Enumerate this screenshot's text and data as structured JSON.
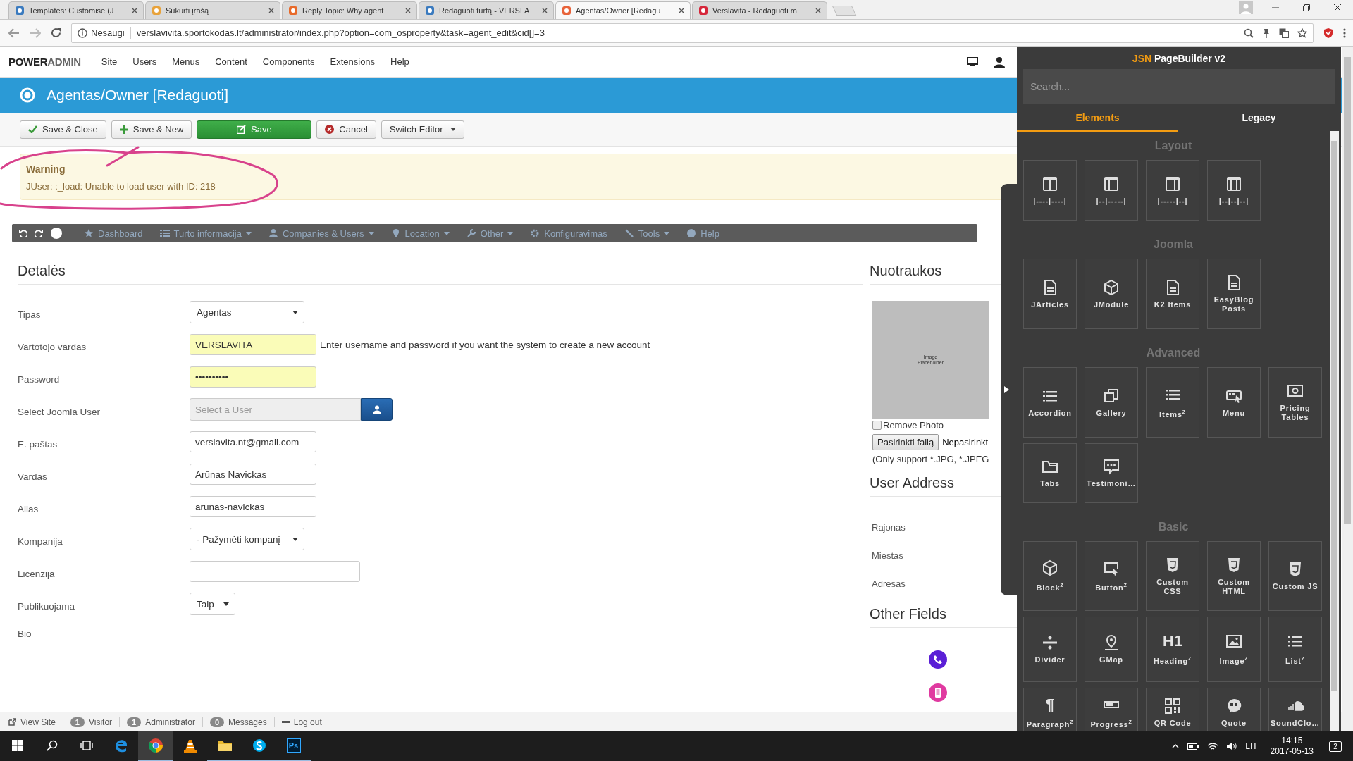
{
  "browser": {
    "tabs": [
      {
        "title": "Templates: Customise (J",
        "selected": false
      },
      {
        "title": "Sukurti įrašą",
        "selected": false
      },
      {
        "title": "Reply Topic: Why agent",
        "selected": false
      },
      {
        "title": "Redaguoti turtą - VERSLA",
        "selected": false
      },
      {
        "title": "Agentas/Owner [Redagu",
        "selected": true
      },
      {
        "title": "Verslavita - Redaguoti m",
        "selected": false
      }
    ],
    "security": "Nesaugi",
    "url": "verslavivita.sportokodas.lt/administrator/index.php?option=com_osproperty&task=agent_edit&cid[]=3"
  },
  "admin": {
    "logo": {
      "strong": "POWER",
      "light": "ADMIN"
    },
    "menu": [
      "Site",
      "Users",
      "Menus",
      "Content",
      "Components",
      "Extensions",
      "Help"
    ]
  },
  "title": "Agentas/Owner [Redaguoti]",
  "toolbar": [
    {
      "label": "Save & Close",
      "kind": "check"
    },
    {
      "label": "Save & New",
      "kind": "plus"
    },
    {
      "label": "Save",
      "kind": "primary"
    },
    {
      "label": "Cancel",
      "kind": "cancel"
    },
    {
      "label": "Switch Editor",
      "kind": "dropdown"
    }
  ],
  "alert": {
    "heading": "Warning",
    "message": "JUser: :_load: Unable to load user with ID: 218"
  },
  "submenu": [
    {
      "label": "Dashboard",
      "dropdown": false
    },
    {
      "label": "Turto informacija",
      "dropdown": true
    },
    {
      "label": "Companies & Users",
      "dropdown": true
    },
    {
      "label": "Location",
      "dropdown": true
    },
    {
      "label": "Other",
      "dropdown": true
    },
    {
      "label": "Konfiguravimas",
      "dropdown": false
    },
    {
      "label": "Tools",
      "dropdown": true
    },
    {
      "label": "Help",
      "dropdown": false
    }
  ],
  "details": {
    "heading": "Detalės",
    "rows": [
      {
        "label": "Tipas",
        "kind": "select",
        "value": "Agentas"
      },
      {
        "label": "Vartotojo vardas",
        "kind": "text",
        "value": "VERSLAVITA",
        "autofilled": true,
        "note": "Enter username and password if you want the system to create a new account"
      },
      {
        "label": "Password",
        "kind": "text",
        "value": "••••••••••",
        "autofilled": true
      },
      {
        "label": "Select Joomla User",
        "kind": "picker",
        "placeholder": "Select a User"
      },
      {
        "label": "E. paštas",
        "kind": "text",
        "value": "verslavita.nt@gmail.com",
        "autofilled": false
      },
      {
        "label": "Vardas",
        "kind": "text",
        "value": "Arūnas  Navickas",
        "autofilled": false
      },
      {
        "label": "Alias",
        "kind": "text",
        "value": "arunas-navickas",
        "autofilled": false
      },
      {
        "label": "Kompanija",
        "kind": "select",
        "value": "- Pažymėti kompanį"
      },
      {
        "label": "Licenzija",
        "kind": "text",
        "autofilled": false
      },
      {
        "label": "Publikuojama",
        "kind": "select",
        "value": "Taip"
      },
      {
        "label": "Bio",
        "kind": "label"
      }
    ]
  },
  "photos": {
    "heading": "Nuotraukos",
    "placeholder_text": "Image Placeholder",
    "remove": {
      "label": "Remove Photo",
      "checked": false
    },
    "file_button": "Pasirinkti failą",
    "file_status": "Nepasirinkt",
    "hint": "(Only support *.JPG, *.JPEG"
  },
  "user_address": {
    "heading": "User Address",
    "fields": [
      "Rajonas",
      "Miestas",
      "Adresas"
    ]
  },
  "other_fields": {
    "heading": "Other Fields",
    "items": [
      {
        "kind": "phone"
      },
      {
        "kind": "mobile"
      }
    ]
  },
  "status_bar": [
    {
      "kind": "link",
      "label": "View Site"
    },
    {
      "kind": "count",
      "count": "1",
      "label": "Visitor"
    },
    {
      "kind": "count",
      "count": "1",
      "label": "Administrator"
    },
    {
      "kind": "count",
      "count": "0",
      "label": "Messages"
    },
    {
      "kind": "logout",
      "label": "Log out"
    }
  ],
  "builder": {
    "brand": "JSN",
    "title": "PageBuilder v2",
    "search_placeholder": "Search...",
    "tabs": [
      {
        "label": "Elements",
        "selected": true
      },
      {
        "label": "Legacy",
        "selected": false
      }
    ],
    "groups": [
      {
        "name": "Layout",
        "items": [
          {
            "label": "|----|----|",
            "kind": "columns"
          },
          {
            "label": "|--|-----|",
            "kind": "columns"
          },
          {
            "label": "|-----|--|",
            "kind": "columns"
          },
          {
            "label": "|--|--|--|",
            "kind": "columns"
          }
        ]
      },
      {
        "name": "Joomla",
        "items": [
          {
            "label": "JArticles",
            "kind": "document"
          },
          {
            "label": "JModule",
            "kind": "cube"
          },
          {
            "label": "K2 Items",
            "kind": "document"
          },
          {
            "label": "EasyBlog Posts",
            "kind": "document"
          }
        ]
      },
      {
        "name": "Advanced",
        "items": [
          {
            "label": "Accordion",
            "kind": "list"
          },
          {
            "label": "Gallery",
            "kind": "gallery"
          },
          {
            "label": "Items$^{Z}$",
            "kind": "list"
          },
          {
            "label": "Menu",
            "kind": "menu"
          },
          {
            "label": "Pricing Tables",
            "kind": "pricing"
          },
          {
            "label": "Tabs",
            "kind": "tabs"
          },
          {
            "label": "Testimoni…",
            "kind": "speech"
          }
        ]
      },
      {
        "name": "Basic",
        "items": [
          {
            "label": "Block$^{Z}$",
            "kind": "cube"
          },
          {
            "label": "Button$^{Z}$",
            "kind": "button"
          },
          {
            "label": "Custom CSS",
            "kind": "shield"
          },
          {
            "label": "Custom HTML",
            "kind": "shield"
          },
          {
            "label": "Custom JS",
            "kind": "shield"
          },
          {
            "label": "Divider",
            "kind": "divider"
          },
          {
            "label": "GMap",
            "kind": "map"
          },
          {
            "label": "Heading$^{Z}$",
            "kind": "glyph",
            "glyph": "H1"
          },
          {
            "label": "Image$^{Z}$",
            "kind": "image"
          },
          {
            "label": "List$^{Z}$",
            "kind": "list"
          },
          {
            "label": "Paragraph$^{Z}$",
            "kind": "glyph",
            "glyph": "¶"
          },
          {
            "label": "Progress$^{Z}$",
            "kind": "progress"
          },
          {
            "label": "QR Code",
            "kind": "qr"
          },
          {
            "label": "Quote",
            "kind": "quote"
          },
          {
            "label": "SoundClo…",
            "kind": "cloud"
          }
        ]
      }
    ]
  },
  "taskbar": {
    "apps": [
      {
        "kind": "start",
        "selected": false,
        "running": false
      },
      {
        "kind": "search",
        "selected": false,
        "running": false
      },
      {
        "kind": "taskview",
        "selected": false,
        "running": false
      },
      {
        "kind": "edge",
        "selected": false,
        "running": false
      },
      {
        "kind": "chrome",
        "selected": true,
        "running": true
      },
      {
        "kind": "vlc",
        "selected": false,
        "running": false
      },
      {
        "kind": "explorer",
        "selected": false,
        "running": true
      },
      {
        "kind": "skype",
        "selected": false,
        "running": true
      },
      {
        "kind": "photoshop",
        "glyph": "Ps",
        "selected": false,
        "running": true
      }
    ],
    "language": "LIT",
    "time": "14:15",
    "date": "2017-05-13",
    "notifications": "2"
  }
}
